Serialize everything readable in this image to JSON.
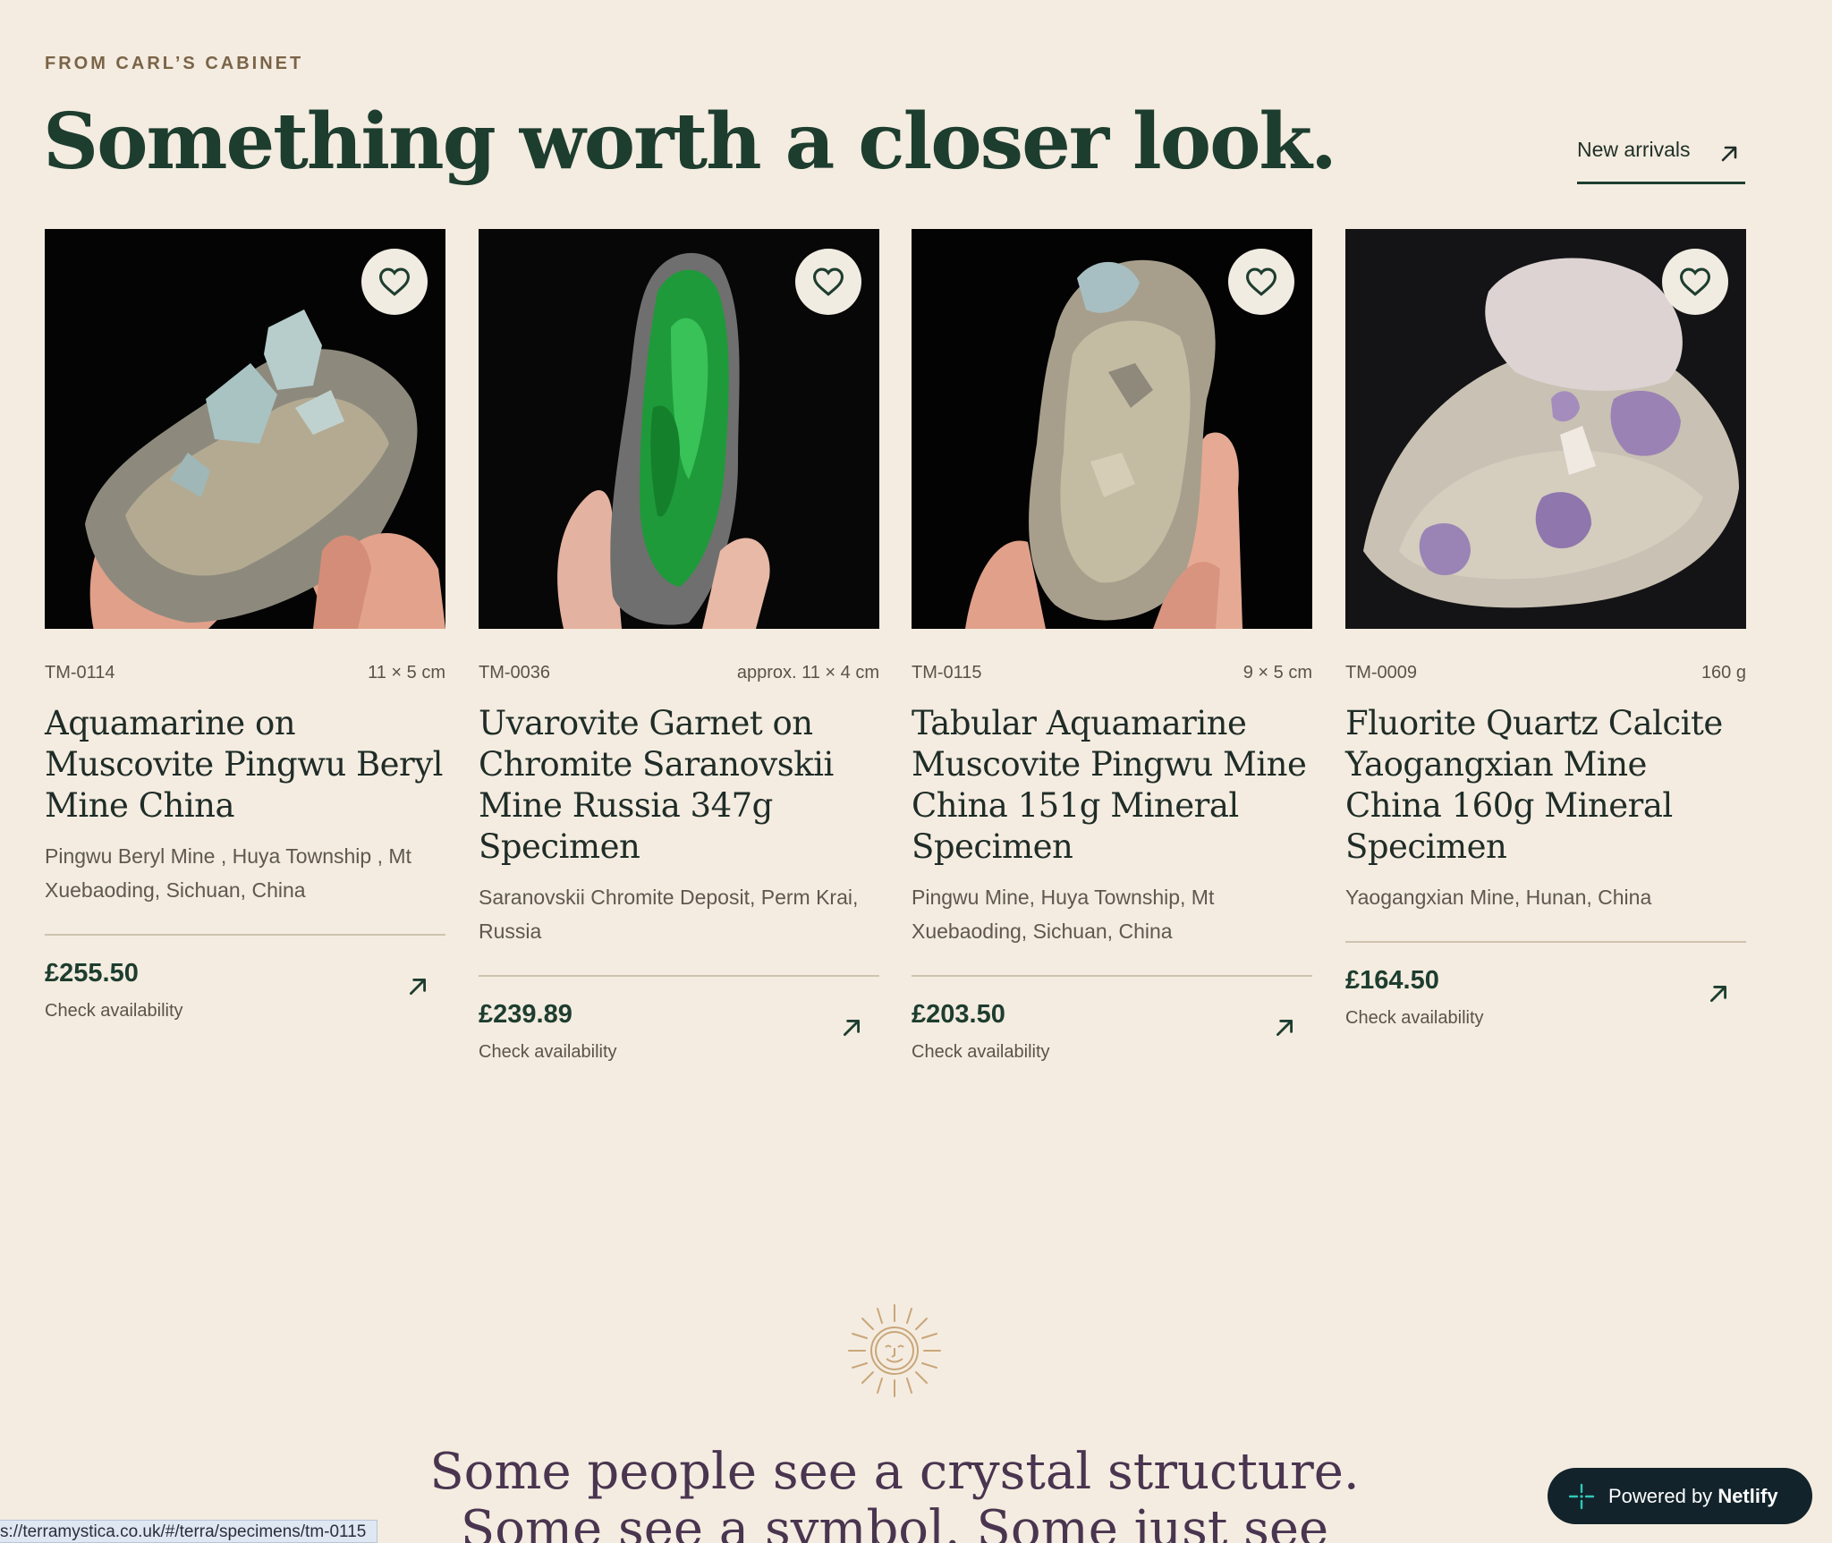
{
  "section": {
    "eyebrow": "FROM CARL’S CABINET",
    "headline": "Something worth a closer look.",
    "new_arrivals_label": "New arrivals"
  },
  "cards": [
    {
      "sku": "TM-0114",
      "size": "11 × 5 cm",
      "title": "Aquamarine on Muscovite Pingwu Beryl Mine China",
      "location": "Pingwu Beryl Mine , Huya Township , Mt Xuebaoding, Sichuan, China",
      "price": "£255.50",
      "availability": "Check availability"
    },
    {
      "sku": "TM-0036",
      "size": "approx. 11 × 4 cm",
      "title": "Uvarovite Garnet on Chromite Saranovskii Mine Russia 347g Specimen",
      "location": "Saranovskii Chromite Deposit, Perm Krai, Russia",
      "price": "£239.89",
      "availability": "Check availability"
    },
    {
      "sku": "TM-0115",
      "size": "9 × 5 cm",
      "title": "Tabular Aquamarine Muscovite Pingwu Mine China 151g Mineral Specimen",
      "location": "Pingwu Mine, Huya Township, Mt Xuebaoding, Sichuan, China",
      "price": "£203.50",
      "availability": "Check availability"
    },
    {
      "sku": "TM-0009",
      "size": "160 g",
      "title": "Fluorite Quartz Calcite Yaogangxian Mine China 160g Mineral Specimen",
      "location": "Yaogangxian Mine, Hunan, China",
      "price": "£164.50",
      "availability": "Check availability"
    }
  ],
  "quote": {
    "line1": "Some people see a crystal structure.",
    "line2": "Some see a symbol. Some just see"
  },
  "status_bar": {
    "url": "s://terramystica.co.uk/#/terra/specimens/tm-0115"
  },
  "badge": {
    "prefix": "Powered by",
    "brand": "Netlify"
  },
  "icons": {
    "favorite": "heart-icon",
    "open": "arrow-up-right-icon",
    "decor": "sun-face-icon",
    "netlify": "netlify-logo-icon"
  },
  "colors": {
    "background": "#f4ece0",
    "heading": "#1d3d2f",
    "quote": "#4a3550",
    "badge": "#12232b"
  }
}
